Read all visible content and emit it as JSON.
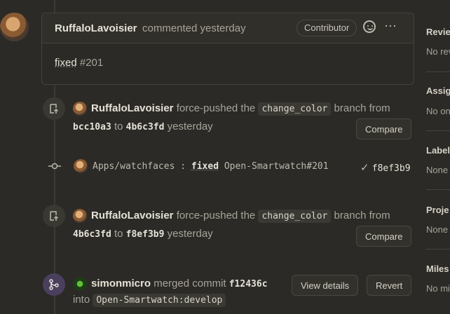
{
  "comment": {
    "author": "RuffaloLavoisier",
    "action": "commented yesterday",
    "badge": "Contributor",
    "body_text": "fixed",
    "body_ref": "#201"
  },
  "events": [
    {
      "author": "RuffaloLavoisier",
      "action": "force-pushed the",
      "branch": "change_color",
      "suffix": "branch from",
      "from_sha": "bcc10a3",
      "to_word": "to",
      "to_sha": "4b6c3fd",
      "time": "yesterday",
      "button": "Compare"
    },
    {
      "author": "RuffaloLavoisier",
      "action": "force-pushed the",
      "branch": "change_color",
      "suffix": "branch from",
      "from_sha": "4b6c3fd",
      "to_word": "to",
      "to_sha": "f8ef3b9",
      "time": "yesterday",
      "button": "Compare"
    }
  ],
  "commit": {
    "path": "Apps/watchfaces :",
    "message_word": "fixed",
    "ref": "Open-Smartwatch#201",
    "sha": "f8ef3b9"
  },
  "merge": {
    "author": "simonmicro",
    "action": "merged commit",
    "sha": "f12436c",
    "into": "into",
    "target": "Open-Smartwatch:develop",
    "view_button": "View details",
    "revert_button": "Revert"
  },
  "sidebar": [
    {
      "title": "Revie",
      "value": "No rev"
    },
    {
      "title": "Assig",
      "value": "No on"
    },
    {
      "title": "Label",
      "value": "None"
    },
    {
      "title": "Proje",
      "value": "None"
    },
    {
      "title": "Miles",
      "value": "No mi"
    }
  ],
  "colors": {
    "background": "#2b2a26",
    "merge_node": "#4b3f5e",
    "text_strong": "#e6e2d8"
  }
}
